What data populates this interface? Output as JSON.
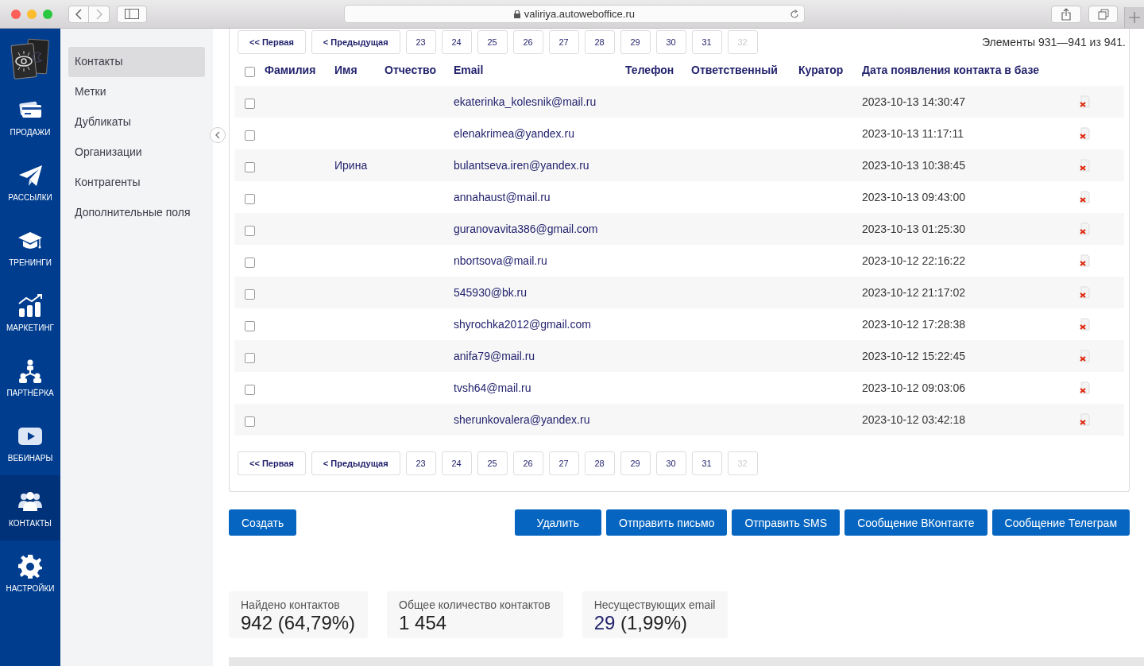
{
  "browser": {
    "url": "valiriya.autoweboffice.ru"
  },
  "rail": [
    {
      "kind": "sales",
      "label": "ПРОДАЖИ",
      "selected": false
    },
    {
      "kind": "mailing",
      "label": "РАССЫЛКИ",
      "selected": false
    },
    {
      "kind": "training",
      "label": "ТРЕНИНГИ",
      "selected": false
    },
    {
      "kind": "marketing",
      "label": "МАРКЕТИНГ",
      "selected": false
    },
    {
      "kind": "partner",
      "label": "ПАРТНЁРКА",
      "selected": false
    },
    {
      "kind": "webinar",
      "label": "ВЕБИНАРЫ",
      "selected": false
    },
    {
      "kind": "contacts",
      "label": "КОНТАКТЫ",
      "selected": true
    },
    {
      "kind": "settings",
      "label": "НАСТРОЙКИ",
      "selected": false
    }
  ],
  "sidebar": {
    "items": [
      {
        "label": "Контакты",
        "selected": true
      },
      {
        "label": "Метки",
        "selected": false
      },
      {
        "label": "Дубликаты",
        "selected": false
      },
      {
        "label": "Организации",
        "selected": false
      },
      {
        "label": "Контрагенты",
        "selected": false
      },
      {
        "label": "Дополнительные поля",
        "selected": false
      }
    ]
  },
  "pagination": [
    {
      "label": "<< Первая",
      "disabled": false
    },
    {
      "label": "< Предыдущая",
      "disabled": false
    },
    {
      "label": "23",
      "disabled": false
    },
    {
      "label": "24",
      "disabled": false
    },
    {
      "label": "25",
      "disabled": false
    },
    {
      "label": "26",
      "disabled": false
    },
    {
      "label": "27",
      "disabled": false
    },
    {
      "label": "28",
      "disabled": false
    },
    {
      "label": "29",
      "disabled": false
    },
    {
      "label": "30",
      "disabled": false
    },
    {
      "label": "31",
      "disabled": false
    },
    {
      "label": "32",
      "disabled": true
    }
  ],
  "summary": "Элементы 931—941 из 941.",
  "table": {
    "select_all": {
      "checked": false
    },
    "columns": [
      "Фамилия",
      "Имя",
      "Отчество",
      "Email",
      "Телефон",
      "Ответственный",
      "Куратор",
      "Дата появления контакта в базе"
    ],
    "rows": [
      {
        "checked": false,
        "email": "ekaterinka_kolesnik@mail.ru",
        "date": "2023-10-13 14:30:47"
      },
      {
        "checked": false,
        "email": "elenakrimea@yandex.ru",
        "date": "2023-10-13 11:17:11"
      },
      {
        "checked": false,
        "first_name": "Ирина",
        "email": "bulantseva.iren@yandex.ru",
        "date": "2023-10-13 10:38:45"
      },
      {
        "checked": false,
        "email": "annahaust@mail.ru",
        "date": "2023-10-13 09:43:00"
      },
      {
        "checked": false,
        "email": "guranovavita386@gmail.com",
        "date": "2023-10-13 01:25:30"
      },
      {
        "checked": false,
        "email": "nbortsova@mail.ru",
        "date": "2023-10-12 22:16:22"
      },
      {
        "checked": false,
        "email": "545930@bk.ru",
        "date": "2023-10-12 21:17:02"
      },
      {
        "checked": false,
        "email": "shyrochka2012@gmail.com",
        "date": "2023-10-12 17:28:38"
      },
      {
        "checked": false,
        "email": "anifa79@mail.ru",
        "date": "2023-10-12 15:22:45"
      },
      {
        "checked": false,
        "email": "tvsh64@mail.ru",
        "date": "2023-10-12 09:03:06"
      },
      {
        "checked": false,
        "email": "sherunkovalera@yandex.ru",
        "date": "2023-10-12 03:42:18"
      }
    ]
  },
  "pagination_bottom": [
    {
      "label": "<< Первая",
      "disabled": false
    },
    {
      "label": "< Предыдущая",
      "disabled": false
    },
    {
      "label": "23",
      "disabled": false
    },
    {
      "label": "24",
      "disabled": false
    },
    {
      "label": "25",
      "disabled": false
    },
    {
      "label": "26",
      "disabled": false
    },
    {
      "label": "27",
      "disabled": false
    },
    {
      "label": "28",
      "disabled": false
    },
    {
      "label": "29",
      "disabled": false
    },
    {
      "label": "30",
      "disabled": false
    },
    {
      "label": "31",
      "disabled": false
    },
    {
      "label": "32",
      "disabled": true
    }
  ],
  "create_button": "Создать",
  "actions": [
    "Удалить",
    "Отправить письмо",
    "Отправить SMS",
    "Сообщение ВКонтакте",
    "Сообщение Телеграм"
  ],
  "stats": [
    {
      "label": "Найдено контактов",
      "value": "942 (64,79%)"
    },
    {
      "label": "Общее количество контактов",
      "value": "1 454"
    },
    {
      "label": "Несуществующих email",
      "value_link": "29",
      "value": "(1,99%)"
    }
  ]
}
